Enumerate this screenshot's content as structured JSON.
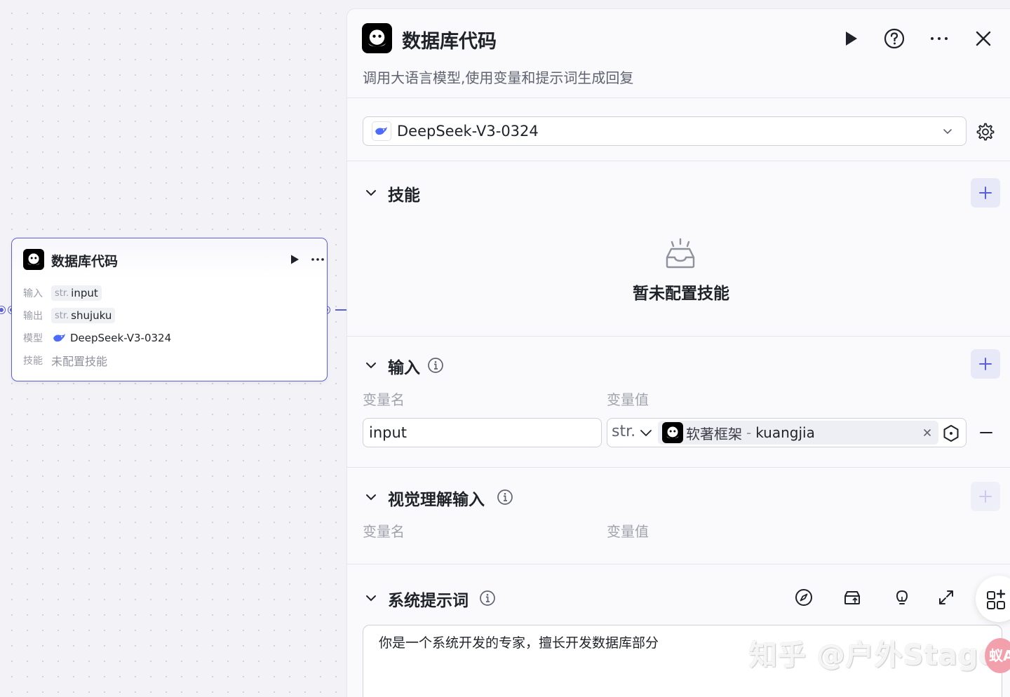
{
  "node": {
    "title": "数据库代码",
    "rows": [
      {
        "label": "输入",
        "type": "str.",
        "value": "input"
      },
      {
        "label": "输出",
        "type": "str.",
        "value": "shujuku"
      },
      {
        "label": "模型",
        "value": "DeepSeek-V3-0324"
      },
      {
        "label": "技能",
        "value": "未配置技能"
      }
    ]
  },
  "panel": {
    "title": "数据库代码",
    "description": "调用大语言模型,使用变量和提示词生成回复",
    "model": {
      "selected": "DeepSeek-V3-0324"
    },
    "skills": {
      "title": "技能",
      "empty_text": "暂未配置技能"
    },
    "inputs": {
      "title": "输入",
      "col_name": "变量名",
      "col_value": "变量值",
      "rows": [
        {
          "name": "input",
          "type": "str.",
          "ref_source": "软著框架",
          "ref_sep": "-",
          "ref_var": "kuangjia"
        }
      ]
    },
    "vision_inputs": {
      "title": "视觉理解输入",
      "col_name": "变量名",
      "col_value": "变量值"
    },
    "system_prompt": {
      "title": "系统提示词",
      "text": "你是一个系统开发的专家，擅长开发数据库部分"
    }
  },
  "watermark": {
    "text": "知乎 @户外Stage",
    "badge": "蚁A"
  },
  "colors": {
    "accent": "#5b5fd9",
    "plus_bg": "#e8e9f8"
  },
  "icons": [
    "bot-logo-icon",
    "play-icon",
    "more-icon",
    "help-icon",
    "close-icon",
    "deepseek-icon",
    "chevron-down-icon",
    "gear-icon",
    "plus-icon",
    "empty-box-icon",
    "info-icon",
    "clear-icon",
    "variable-picker-icon",
    "minus-icon",
    "compass-icon",
    "template-icon",
    "bulb-icon",
    "expand-icon",
    "apps-icon"
  ]
}
